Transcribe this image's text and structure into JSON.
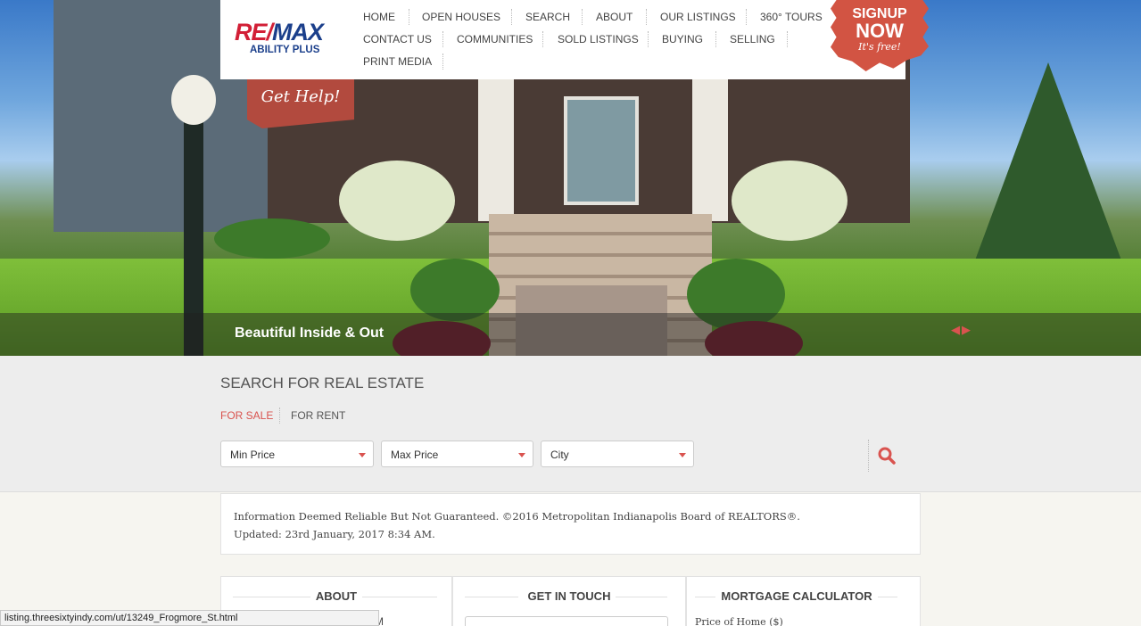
{
  "header": {
    "logo_main_red": "RE/",
    "logo_main_blue": "MAX",
    "logo_sub": "ABILITY PLUS",
    "nav": [
      "HOME",
      "OPEN HOUSES",
      "SEARCH",
      "ABOUT",
      "OUR LISTINGS",
      "360° TOURS",
      "CONTACT US",
      "COMMUNITIES",
      "SOLD LISTINGS",
      "BUYING",
      "SELLING",
      "PRINT MEDIA"
    ],
    "signup_line1": "SIGNUP",
    "signup_line2": "NOW",
    "signup_line3": "It's free!",
    "get_help": "Get Help!"
  },
  "hero": {
    "caption": "Beautiful Inside & Out",
    "arrows_icon": "prev-next-arrows-icon"
  },
  "search": {
    "title": "SEARCH FOR REAL ESTATE",
    "tabs": [
      "FOR SALE",
      "FOR RENT"
    ],
    "active_tab": "FOR SALE",
    "min_price": "Min Price",
    "max_price": "Max Price",
    "city": "City",
    "search_icon": "search-icon"
  },
  "info": {
    "line1": "Information Deemed Reliable But Not Guaranteed. ©2016 Metropolitan Indianapolis Board of REALTORS®.",
    "line2": "Updated: 23rd January, 2017 8:34 AM."
  },
  "footer": {
    "about_title": "ABOUT",
    "contact_title": "GET IN TOUCH",
    "mortgage_title": "MORTGAGE CALCULATOR",
    "mortgage_label": "Price of Home ($)",
    "about_fragment": "M"
  },
  "status_bar": {
    "url": "listing.threesixtyindy.com/ut/13249_Frogmore_St.html"
  },
  "colors": {
    "accent_red": "#d9534f",
    "remax_red": "#d21f36",
    "remax_blue": "#1b3f8b",
    "signup_red": "#d25443"
  }
}
